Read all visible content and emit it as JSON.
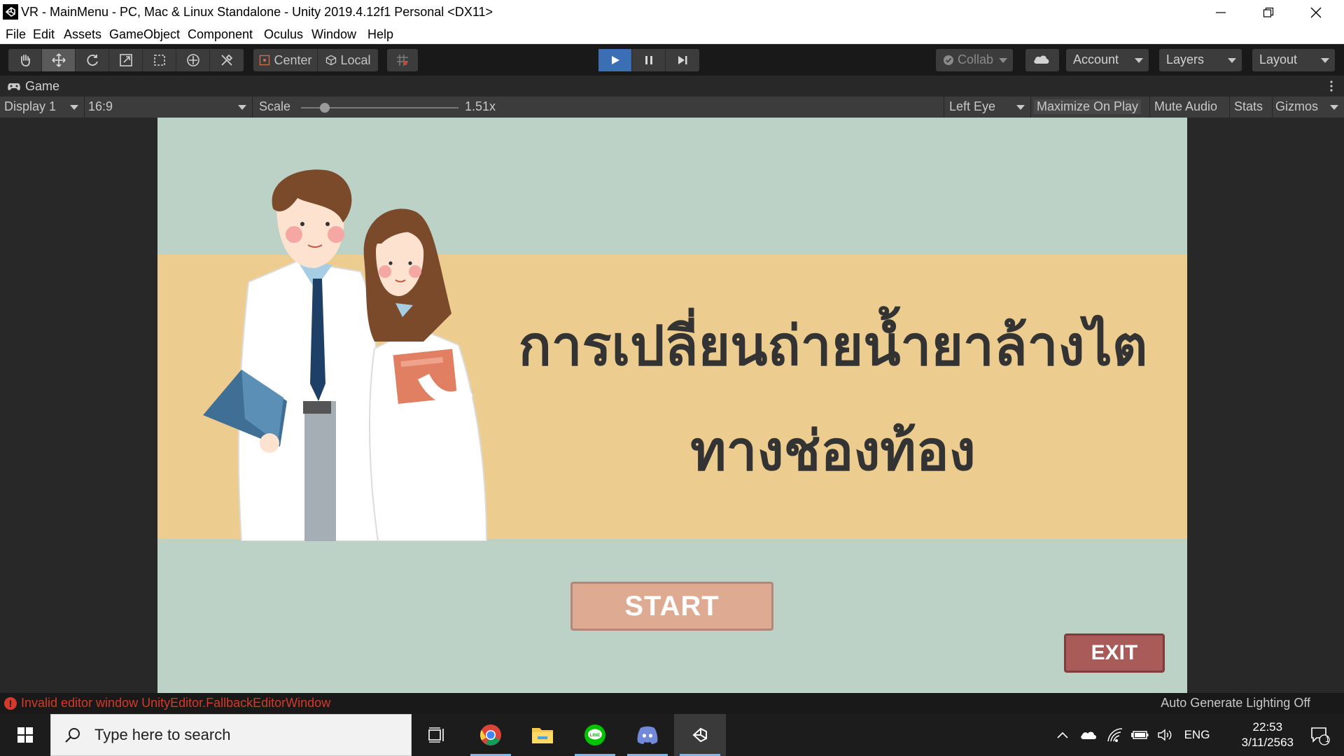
{
  "window": {
    "title": "VR - MainMenu - PC, Mac & Linux Standalone - Unity 2019.4.12f1 Personal <DX11>"
  },
  "menu": {
    "items": [
      "File",
      "Edit",
      "Assets",
      "GameObject",
      "Component",
      "Oculus",
      "Window",
      "Help"
    ]
  },
  "toolbar": {
    "pivot_label": "Center",
    "space_label": "Local",
    "collab_label": "Collab",
    "account_label": "Account",
    "layers_label": "Layers",
    "layout_label": "Layout"
  },
  "game_tab": {
    "label": "Game"
  },
  "game_bar": {
    "display": "Display 1",
    "aspect": "16:9",
    "scale_label": "Scale",
    "scale_value": "1.51x",
    "scale_slider_level": 0.15,
    "eye": "Left Eye",
    "maximize": "Maximize On Play",
    "mute": "Mute Audio",
    "stats": "Stats",
    "gizmos": "Gizmos"
  },
  "game": {
    "heading_line1": "การเปลี่ยนถ่ายน้ำยาล้างไต",
    "heading_line2": "ทางช่องท้อง",
    "start_label": "START",
    "exit_label": "EXIT",
    "colors": {
      "background": "#bcd2c7",
      "band": "#edcc90",
      "start": "#dfaa92",
      "exit": "#a85b59"
    }
  },
  "status": {
    "error": "Invalid editor window UnityEditor.FallbackEditorWindow",
    "lighting": "Auto Generate Lighting Off"
  },
  "taskbar": {
    "search_placeholder": "Type here to search",
    "language": "ENG",
    "time": "22:53",
    "date": "3/11/2563",
    "notification_count": "1",
    "apps": [
      "task-view",
      "chrome",
      "file-explorer",
      "line",
      "discord",
      "unity"
    ]
  }
}
